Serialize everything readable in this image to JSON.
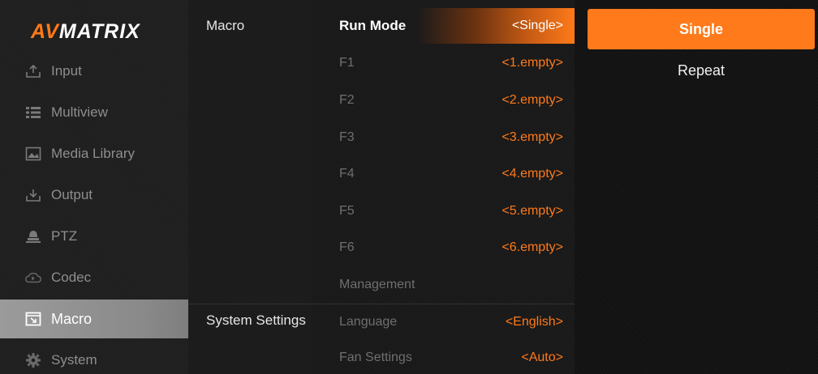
{
  "logo": {
    "part1": "AV",
    "part2": "MATRIX"
  },
  "nav": {
    "items": [
      {
        "label": "Input",
        "icon": "upload-icon"
      },
      {
        "label": "Multiview",
        "icon": "list-icon"
      },
      {
        "label": "Media Library",
        "icon": "image-icon"
      },
      {
        "label": "Output",
        "icon": "download-icon"
      },
      {
        "label": "PTZ",
        "icon": "camera-icon"
      },
      {
        "label": "Codec",
        "icon": "cloud-icon"
      },
      {
        "label": "Macro",
        "icon": "macro-icon",
        "active": true
      },
      {
        "label": "System",
        "icon": "gear-icon"
      }
    ]
  },
  "categories": {
    "macro": "Macro",
    "system": "System Settings"
  },
  "settings": {
    "run_mode": {
      "name": "Run Mode",
      "value": "<Single>"
    },
    "f1": {
      "name": "F1",
      "value": "<1.empty>"
    },
    "f2": {
      "name": "F2",
      "value": "<2.empty>"
    },
    "f3": {
      "name": "F3",
      "value": "<3.empty>"
    },
    "f4": {
      "name": "F4",
      "value": "<4.empty>"
    },
    "f5": {
      "name": "F5",
      "value": "<5.empty>"
    },
    "f6": {
      "name": "F6",
      "value": "<6.empty>"
    },
    "management": {
      "name": "Management",
      "value": ""
    },
    "language": {
      "name": "Language",
      "value": "<English>"
    },
    "fan": {
      "name": "Fan Settings",
      "value": "<Auto>"
    }
  },
  "options": {
    "single": "Single",
    "repeat": "Repeat"
  },
  "colors": {
    "accent": "#ff7a1a",
    "nav_active": "#8a8a8a"
  }
}
